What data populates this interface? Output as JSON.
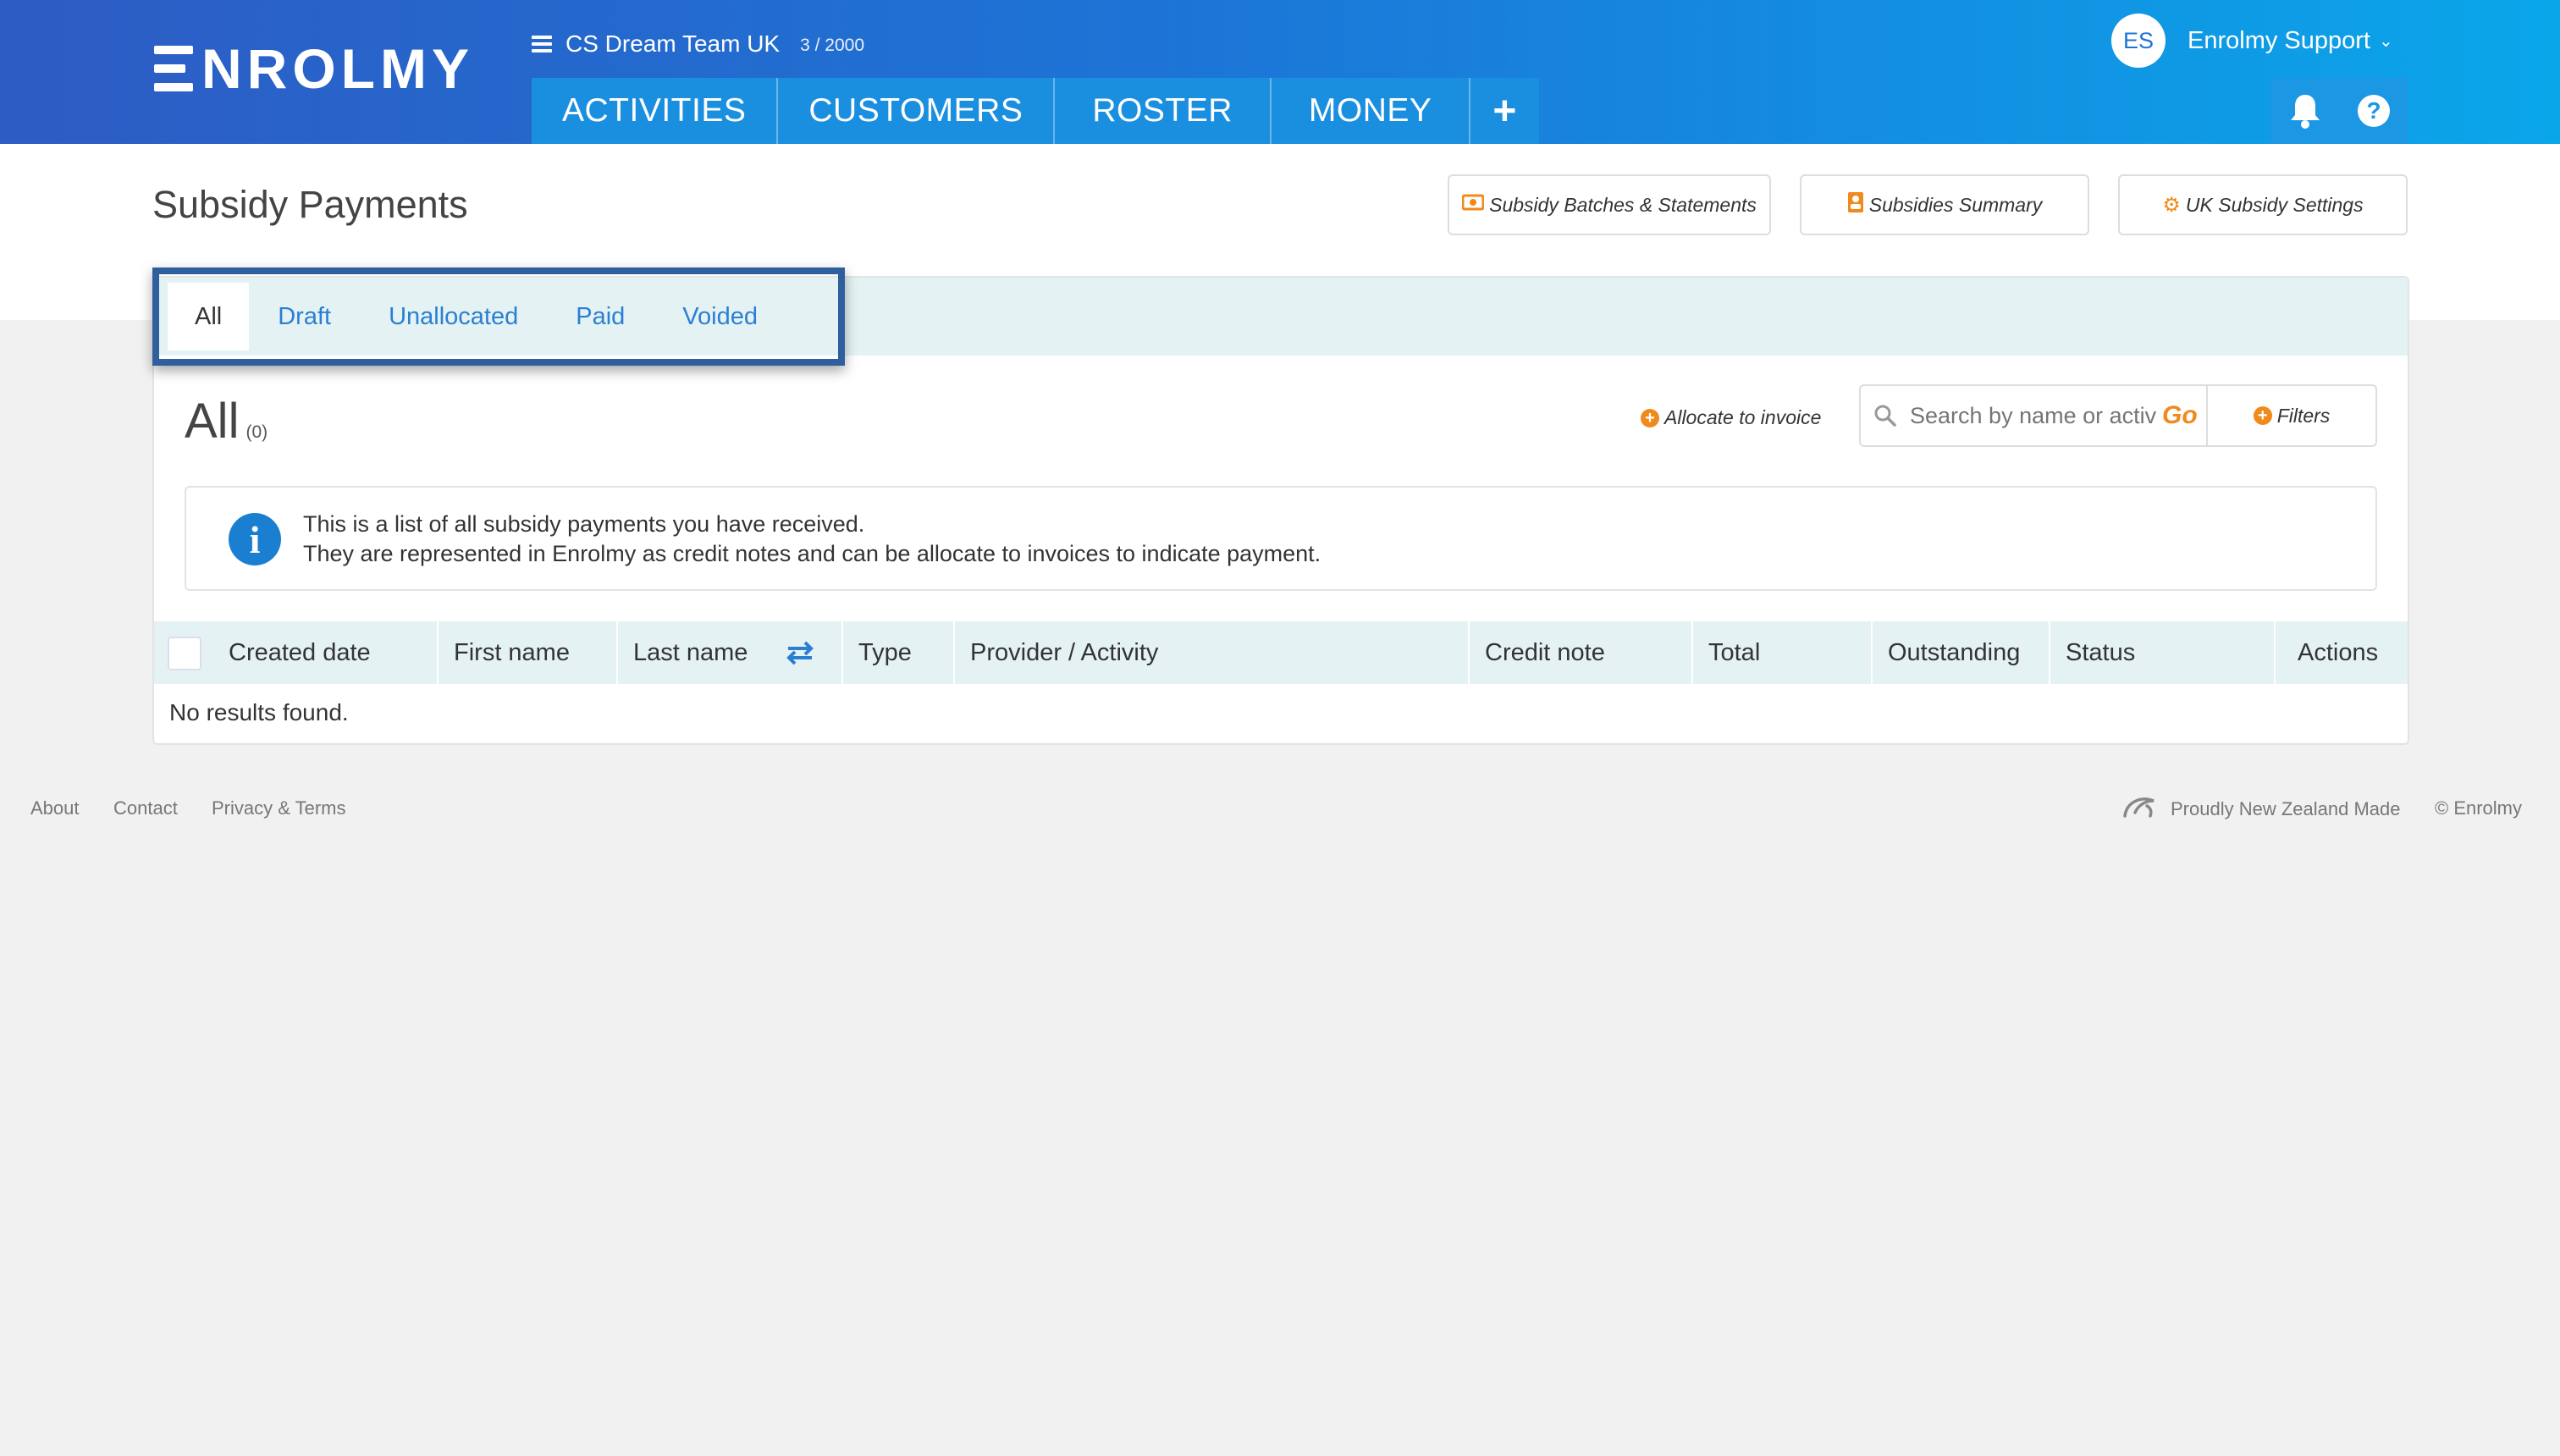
{
  "header": {
    "logo_text": "NROLMY",
    "org_name": "CS Dream Team UK",
    "org_count": "3 / 2000",
    "nav": [
      "ACTIVITIES",
      "CUSTOMERS",
      "ROSTER",
      "MONEY"
    ],
    "nav_plus": "+",
    "user_initials": "ES",
    "user_name": "Enrolmy Support",
    "help_label": "?"
  },
  "page": {
    "title": "Subsidy Payments",
    "buttons": {
      "batches": "Subsidy Batches & Statements",
      "summary": "Subsidies Summary",
      "settings": "UK Subsidy Settings"
    }
  },
  "tabs": {
    "items": [
      "All",
      "Draft",
      "Unallocated",
      "Paid",
      "Voided"
    ],
    "active": "All"
  },
  "list": {
    "heading": "All",
    "count": "(0)",
    "allocate_label": "Allocate to invoice",
    "search_placeholder": "Search by name or activity",
    "go_label": "Go",
    "filters_label": "Filters"
  },
  "info": {
    "line1": "This is a list of all subsidy payments you have received.",
    "line2": "They are represented in Enrolmy as credit notes and can be allocate to invoices to indicate payment."
  },
  "table": {
    "columns": [
      "Created date",
      "First name",
      "Last name",
      "Type",
      "Provider / Activity",
      "Credit note",
      "Total",
      "Outstanding",
      "Status",
      "Actions"
    ],
    "empty_text": "No results found."
  },
  "footer": {
    "links": [
      "About",
      "Contact",
      "Privacy & Terms"
    ],
    "made_in": "Proudly New Zealand Made",
    "copyright": "© Enrolmy"
  },
  "colors": {
    "header_gradient_start": "#2d5cc4",
    "header_gradient_end": "#0aa6ea",
    "link_blue": "#2a7fd3",
    "accent_orange": "#f08a1c",
    "tab_strip_bg": "#e4f2f3",
    "highlight_border": "#2f5f9c"
  },
  "icons": {
    "menu": "hamburger-icon",
    "bell": "bell-icon",
    "help": "help-icon",
    "search": "search-icon",
    "info": "info-icon",
    "sort": "swap-arrows-icon",
    "fern": "fern-icon"
  }
}
